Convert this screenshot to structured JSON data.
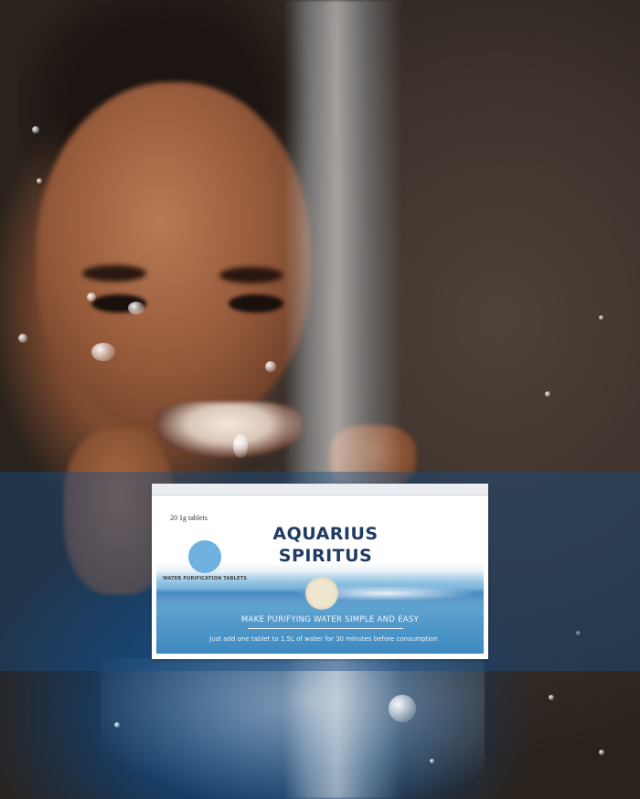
{
  "product": {
    "tablet_count": "20 1g tablets",
    "subtitle": "WATER PURIFICATION TABLETS",
    "brand_line1": "AQUARIUS",
    "brand_line2": "SPIRITUS",
    "tagline": "MAKE PURIFYING WATER SIMPLE AND EASY",
    "instructions": "Just add one tablet to 1.5L of water for 30 minutes before consumption"
  },
  "colors": {
    "brand_text": "#1f3a64",
    "band_overlay": "#194e82",
    "tablet_blue": "#6fb2e0",
    "tablet_white": "#efe6cf"
  }
}
